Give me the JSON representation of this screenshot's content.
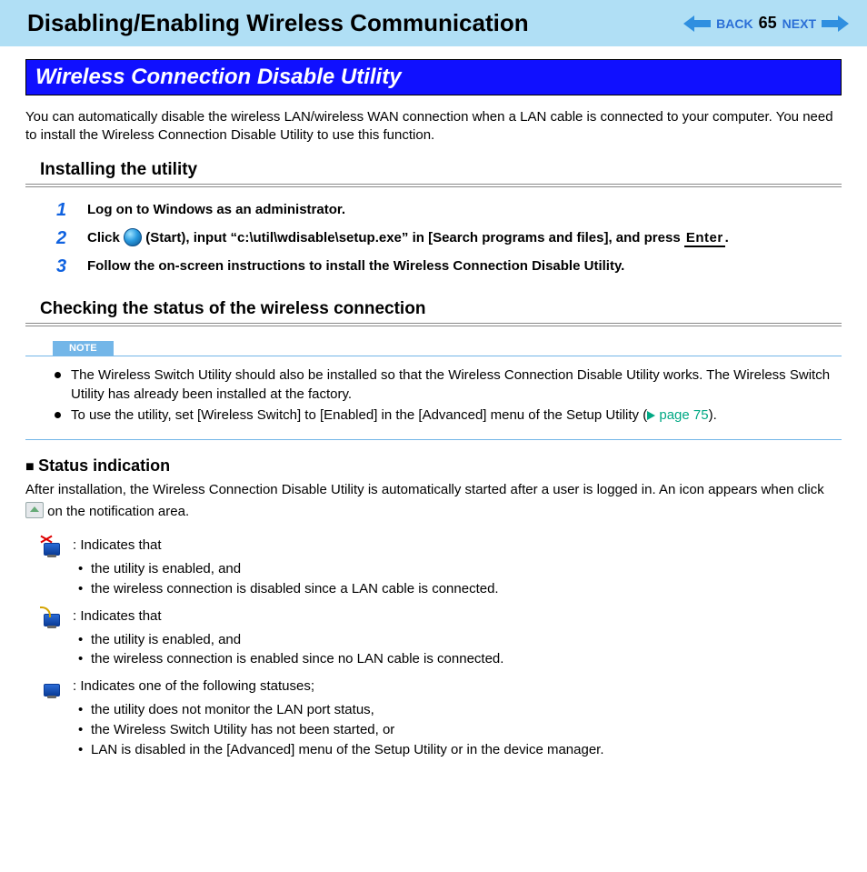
{
  "header": {
    "title": "Disabling/Enabling Wireless Communication",
    "back": "BACK",
    "next": "NEXT",
    "page": "65"
  },
  "banner": "Wireless Connection Disable Utility",
  "intro": "You can automatically disable the wireless LAN/wireless WAN connection when a LAN cable is connected to your computer. You need to install the Wireless Connection Disable Utility to use this function.",
  "install_h": "Installing the utility",
  "steps": {
    "s1": "Log on to Windows as an administrator.",
    "s2a": "Click ",
    "s2b": " (Start), input “c:\\util\\wdisable\\setup.exe” in [Search programs and files], and press ",
    "s2key": "Enter",
    "s2c": ".",
    "s3": "Follow the on-screen instructions to install the Wireless Connection Disable Utility."
  },
  "check_h": "Checking the status of the wireless connection",
  "note_label": "NOTE",
  "notes": {
    "n1": "The Wireless Switch Utility should also be installed so that the Wireless Connection Disable Utility works. The Wireless Switch Utility has already been installed at the factory.",
    "n2a": "To use the utility, set [Wireless Switch] to [Enabled] in the [Advanced] menu of the Setup Utility (",
    "n2link": "page 75",
    "n2b": ")."
  },
  "status_h": "Status indication",
  "status_intro_a": "After installation, the Wireless Connection Disable Utility is automatically started after a user is logged in. An icon appears when click ",
  "status_intro_b": " on the notification area.",
  "rows": {
    "r1": ": Indicates that",
    "r1b1": "the utility is enabled, and",
    "r1b2": "the wireless connection is disabled since a LAN cable is connected.",
    "r2": ": Indicates that",
    "r2b1": "the utility is enabled, and",
    "r2b2": "the wireless connection is enabled since no LAN cable is connected.",
    "r3": ": Indicates one of the following statuses;",
    "r3b1": "the utility does not monitor the LAN port status,",
    "r3b2": "the Wireless Switch Utility has not been started, or",
    "r3b3": "LAN is disabled in the [Advanced] menu of the Setup Utility or in the device manager."
  }
}
